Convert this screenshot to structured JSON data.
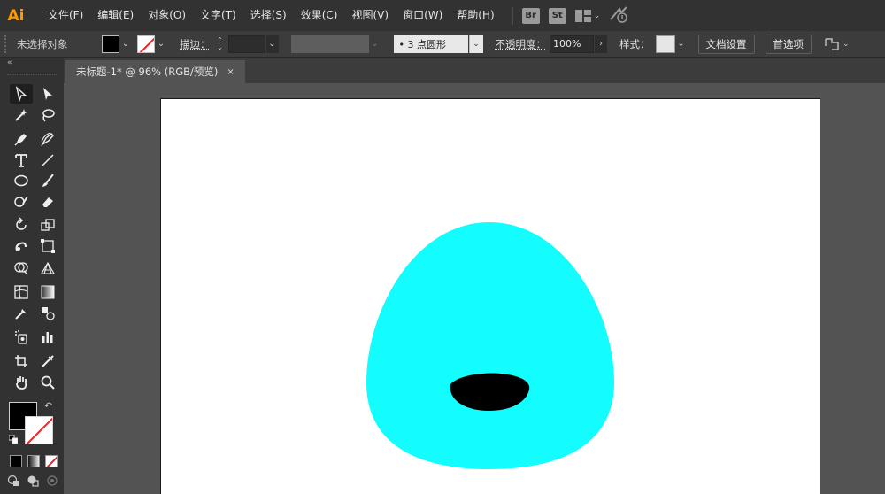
{
  "app": {
    "logo": "Ai"
  },
  "menu": [
    "文件(F)",
    "编辑(E)",
    "对象(O)",
    "文字(T)",
    "选择(S)",
    "效果(C)",
    "视图(V)",
    "窗口(W)",
    "帮助(H)"
  ],
  "menu_right": {
    "bridge": "Br",
    "stock": "St"
  },
  "control_bar": {
    "selection_status": "未选择对象",
    "stroke_label": "描边：",
    "brush_value": "• 3 点圆形",
    "opacity_label": "不透明度：",
    "opacity_value": "100%",
    "style_label": "样式：",
    "doc_setup_button": "文档设置",
    "preferences_button": "首选项"
  },
  "document_tab": {
    "title": "未标题-1* @ 96% (RGB/预览)",
    "close": "×"
  },
  "colors": {
    "shape_fill": "#13fdff",
    "mouth_fill": "#000000",
    "fill_swatch": "#000000",
    "stroke_swatch": "none"
  },
  "toolbar": {
    "tools": [
      "selection-tool",
      "direct-selection-tool",
      "magic-wand-tool",
      "lasso-tool",
      "pen-tool",
      "curvature-tool",
      "type-tool",
      "line-segment-tool",
      "ellipse-tool",
      "paintbrush-tool",
      "shaper-tool",
      "eraser-tool",
      "rotate-tool",
      "scale-tool",
      "warp-tool",
      "free-transform-tool",
      "shape-builder-tool",
      "perspective-grid-tool",
      "mesh-tool",
      "gradient-tool",
      "eyedropper-tool",
      "blend-tool",
      "symbol-sprayer-tool",
      "column-graph-tool",
      "artboard-tool",
      "slice-tool",
      "hand-tool",
      "zoom-tool"
    ]
  }
}
